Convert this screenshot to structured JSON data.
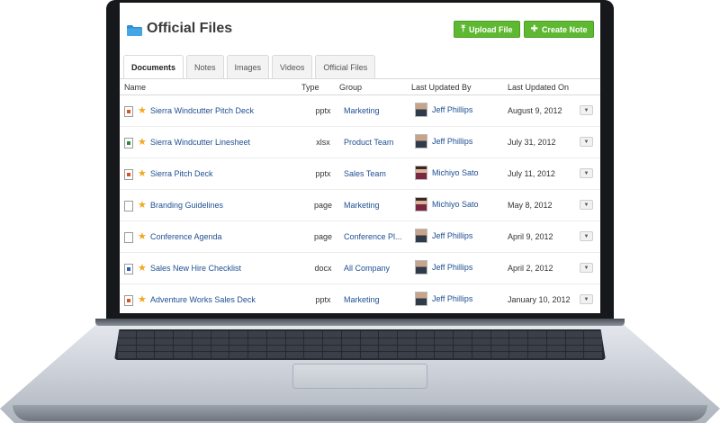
{
  "header": {
    "title": "Official Files",
    "upload_label": "Upload File",
    "create_note_label": "Create Note",
    "accent_color": "#5fb832"
  },
  "tabs": [
    {
      "label": "Documents",
      "active": true
    },
    {
      "label": "Notes",
      "active": false
    },
    {
      "label": "Images",
      "active": false
    },
    {
      "label": "Videos",
      "active": false
    },
    {
      "label": "Official Files",
      "active": false
    }
  ],
  "table": {
    "columns": [
      "Name",
      "Type",
      "Group",
      "Last Updated By",
      "Last Updated On"
    ],
    "rows": [
      {
        "icon": "pptx",
        "name": "Sierra Windcutter Pitch Deck",
        "type": "pptx",
        "group": "Marketing",
        "user": "Jeff Phillips",
        "date": "August 9, 2012"
      },
      {
        "icon": "xlsx",
        "name": "Sierra Windcutter Linesheet",
        "type": "xlsx",
        "group": "Product Team",
        "user": "Jeff Phillips",
        "date": "July 31, 2012"
      },
      {
        "icon": "pptx",
        "name": "Sierra Pitch Deck",
        "type": "pptx",
        "group": "Sales Team",
        "user": "Michiyo Sato",
        "date": "July 11, 2012"
      },
      {
        "icon": "page",
        "name": "Branding Guidelines",
        "type": "page",
        "group": "Marketing",
        "user": "Michiyo Sato",
        "date": "May 8, 2012"
      },
      {
        "icon": "page",
        "name": "Conference Agenda",
        "type": "page",
        "group": "Conference Pl...",
        "user": "Jeff Phillips",
        "date": "April 9, 2012"
      },
      {
        "icon": "docx",
        "name": "Sales New Hire Checklist",
        "type": "docx",
        "group": "All Company",
        "user": "Jeff Phillips",
        "date": "April 2, 2012"
      },
      {
        "icon": "pptx",
        "name": "Adventure Works Sales Deck",
        "type": "pptx",
        "group": "Marketing",
        "user": "Jeff Phillips",
        "date": "January 10, 2012"
      }
    ]
  }
}
